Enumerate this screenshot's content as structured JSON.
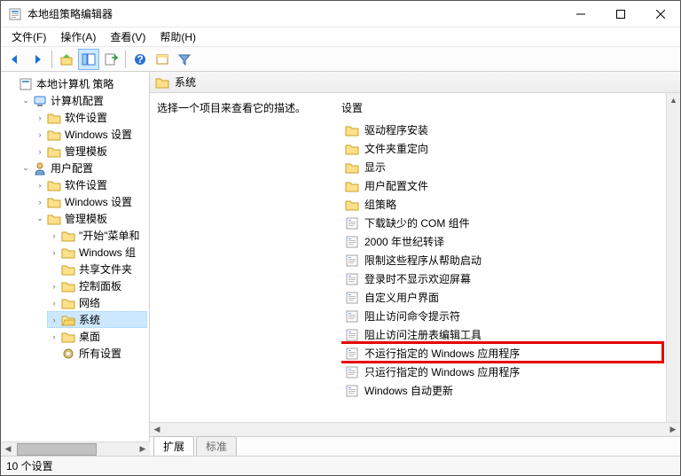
{
  "window": {
    "title": "本地组策略编辑器"
  },
  "menu": {
    "file": "文件(F)",
    "action": "操作(A)",
    "view": "查看(V)",
    "help": "帮助(H)"
  },
  "tree": {
    "root": "本地计算机 策略",
    "computer": "计算机配置",
    "comp_software": "软件设置",
    "comp_windows": "Windows 设置",
    "comp_admin": "管理模板",
    "user": "用户配置",
    "user_software": "软件设置",
    "user_windows": "Windows 设置",
    "user_admin": "管理模板",
    "start_menu": "\"开始\"菜单和",
    "windows_comp": "Windows 组",
    "shared": "共享文件夹",
    "control": "控制面板",
    "network": "网络",
    "system": "系统",
    "desktop": "桌面",
    "all": "所有设置"
  },
  "content": {
    "header": "系统",
    "description": "选择一个项目来查看它的描述。",
    "column": "设置",
    "items": [
      {
        "type": "folder",
        "label": "驱动程序安装"
      },
      {
        "type": "folder",
        "label": "文件夹重定向"
      },
      {
        "type": "folder",
        "label": "显示"
      },
      {
        "type": "folder",
        "label": "用户配置文件"
      },
      {
        "type": "folder",
        "label": "组策略"
      },
      {
        "type": "setting",
        "label": "下载缺少的 COM 组件"
      },
      {
        "type": "setting",
        "label": "2000 年世纪转译"
      },
      {
        "type": "setting",
        "label": "限制这些程序从帮助启动"
      },
      {
        "type": "setting",
        "label": "登录时不显示欢迎屏幕"
      },
      {
        "type": "setting",
        "label": "自定义用户界面"
      },
      {
        "type": "setting",
        "label": "阻止访问命令提示符"
      },
      {
        "type": "setting",
        "label": "阻止访问注册表编辑工具"
      },
      {
        "type": "setting",
        "label": "不运行指定的 Windows 应用程序",
        "highlighted": true
      },
      {
        "type": "setting",
        "label": "只运行指定的 Windows 应用程序"
      },
      {
        "type": "setting",
        "label": "Windows 自动更新"
      }
    ]
  },
  "tabs": {
    "extended": "扩展",
    "standard": "标准"
  },
  "status": "10 个设置"
}
